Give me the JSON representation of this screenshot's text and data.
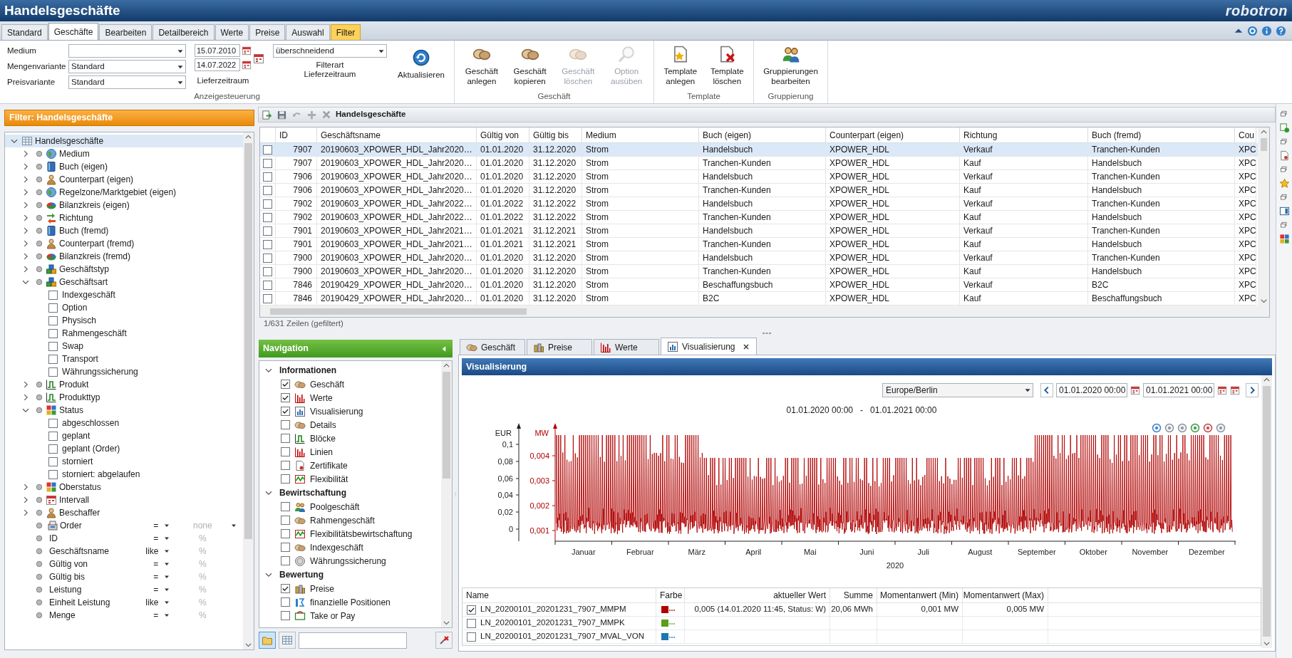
{
  "window": {
    "title": "Handelsgeschäfte",
    "brand": "robotron"
  },
  "tabs": [
    {
      "label": "Standard",
      "selected": false,
      "kind": "normal"
    },
    {
      "label": "Geschäfte",
      "selected": true,
      "kind": "normal"
    },
    {
      "label": "Bearbeiten",
      "selected": false,
      "kind": "normal"
    },
    {
      "label": "Detailbereich",
      "selected": false,
      "kind": "normal"
    },
    {
      "label": "Werte",
      "selected": false,
      "kind": "normal"
    },
    {
      "label": "Preise",
      "selected": false,
      "kind": "normal"
    },
    {
      "label": "Auswahl",
      "selected": false,
      "kind": "normal"
    },
    {
      "label": "Filter",
      "selected": false,
      "kind": "context"
    }
  ],
  "display_settings": {
    "group_label": "Anzeigesteuerung",
    "fields": [
      {
        "label": "Medium"
      },
      {
        "label": "Mengenvariante",
        "value": "Standard"
      },
      {
        "label": "Preisvariante",
        "value": "Standard"
      }
    ],
    "dates": [
      "15.07.2010",
      "14.07.2022"
    ],
    "dates_label": "Lieferzeitraum",
    "filter_mode": "überschneidend",
    "filter_mode_label": "Filterart\nLieferzeitraum",
    "refresh_button": "Aktualisieren"
  },
  "ribbon_groups": [
    {
      "label": "Geschäft",
      "buttons": [
        {
          "label": "Geschäft\nanlegen",
          "disabled": false
        },
        {
          "label": "Geschäft\nkopieren",
          "disabled": false
        },
        {
          "label": "Geschäft\nlöschen",
          "disabled": true
        },
        {
          "label": "Option\nausüben",
          "disabled": true
        }
      ]
    },
    {
      "label": "Template",
      "buttons": [
        {
          "label": "Template\nanlegen",
          "disabled": false
        },
        {
          "label": "Template\nlöschen",
          "disabled": false
        }
      ]
    },
    {
      "label": "Gruppierung",
      "buttons": [
        {
          "label": "Gruppierungen\nbearbeiten",
          "disabled": false
        }
      ]
    }
  ],
  "filter": {
    "title": "Filter: Handelsgeschäfte",
    "tree": {
      "label": "Handelsgeschäfte",
      "expanded": true,
      "selected": true,
      "children": [
        {
          "kind": "category",
          "label": "Medium",
          "expanded": false,
          "selected": false
        },
        {
          "kind": "category",
          "label": "Buch (eigen)",
          "expanded": false,
          "selected": false
        },
        {
          "kind": "category",
          "label": "Counterpart (eigen)",
          "expanded": false,
          "selected": false
        },
        {
          "kind": "category",
          "label": "Regelzone/Marktgebiet (eigen)",
          "expanded": false,
          "selected": false
        },
        {
          "kind": "category",
          "label": "Bilanzkreis (eigen)",
          "expanded": false,
          "selected": false
        },
        {
          "kind": "category",
          "label": "Richtung",
          "expanded": false,
          "selected": false
        },
        {
          "kind": "category",
          "label": "Buch (fremd)",
          "expanded": false,
          "selected": false
        },
        {
          "kind": "category",
          "label": "Counterpart (fremd)",
          "expanded": false,
          "selected": false
        },
        {
          "kind": "category",
          "label": "Bilanzkreis (fremd)",
          "expanded": false,
          "selected": false
        },
        {
          "kind": "category",
          "label": "Geschäftstyp",
          "expanded": false,
          "selected": false
        },
        {
          "kind": "category",
          "label": "Geschäftsart",
          "expanded": true,
          "selected": false,
          "children": [
            {
              "label": "Indexgeschäft",
              "checked": false
            },
            {
              "label": "Option",
              "checked": false
            },
            {
              "label": "Physisch",
              "checked": false
            },
            {
              "label": "Rahmengeschäft",
              "checked": false
            },
            {
              "label": "Swap",
              "checked": false
            },
            {
              "label": "Transport",
              "checked": false
            },
            {
              "label": "Währungssicherung",
              "checked": false
            }
          ]
        },
        {
          "kind": "category",
          "label": "Produkt",
          "expanded": false,
          "selected": false
        },
        {
          "kind": "category",
          "label": "Produkttyp",
          "expanded": false,
          "selected": false
        },
        {
          "kind": "category",
          "label": "Status",
          "expanded": true,
          "selected": false,
          "children": [
            {
              "label": "abgeschlossen",
              "checked": false
            },
            {
              "label": "geplant",
              "checked": false
            },
            {
              "label": "geplant (Order)",
              "checked": false
            },
            {
              "label": "storniert",
              "checked": false
            },
            {
              "label": "storniert: abgelaufen",
              "checked": false
            }
          ]
        },
        {
          "kind": "category",
          "label": "Oberstatus",
          "expanded": false,
          "selected": false
        },
        {
          "kind": "category",
          "label": "Intervall",
          "expanded": false,
          "selected": false
        },
        {
          "kind": "category",
          "label": "Beschaffer",
          "expanded": false,
          "selected": false
        },
        {
          "kind": "field",
          "label": "Order",
          "operator": "=",
          "placeholder": "none",
          "list": true,
          "selected": false
        },
        {
          "kind": "field",
          "label": "ID",
          "operator": "=",
          "placeholder": "%",
          "list": false,
          "selected": false
        },
        {
          "kind": "field",
          "label": "Geschäftsname",
          "operator": "like",
          "placeholder": "%",
          "list": false,
          "selected": false
        },
        {
          "kind": "field",
          "label": "Gültig von",
          "operator": "=",
          "placeholder": "%",
          "list": false,
          "selected": false
        },
        {
          "kind": "field",
          "label": "Gültig bis",
          "operator": "=",
          "placeholder": "%",
          "list": false,
          "selected": false
        },
        {
          "kind": "field",
          "label": "Leistung",
          "operator": "=",
          "placeholder": "%",
          "list": false,
          "selected": false
        },
        {
          "kind": "field",
          "label": "Einheit Leistung",
          "operator": "like",
          "placeholder": "%",
          "list": false,
          "selected": false
        },
        {
          "kind": "field",
          "label": "Menge",
          "operator": "=",
          "placeholder": "%",
          "list": false,
          "selected": false
        }
      ]
    }
  },
  "table": {
    "title": "Handelsgeschäfte",
    "columns": [
      "ID",
      "Geschäftsname",
      "Gültig von",
      "Gültig bis",
      "Medium",
      "Buch (eigen)",
      "Counterpart (eigen)",
      "Richtung",
      "Buch (fremd)",
      "Cou"
    ],
    "rows": [
      {
        "selected": true,
        "checked": false,
        "cells": [
          "7907",
          "20190603_XPOWER_HDL_Jahr2020…",
          "01.01.2020",
          "31.12.2020",
          "Strom",
          "Handelsbuch",
          "XPOWER_HDL",
          "Verkauf",
          "Tranchen-Kunden",
          "XPC"
        ]
      },
      {
        "selected": false,
        "checked": false,
        "cells": [
          "7907",
          "20190603_XPOWER_HDL_Jahr2020…",
          "01.01.2020",
          "31.12.2020",
          "Strom",
          "Tranchen-Kunden",
          "XPOWER_HDL",
          "Kauf",
          "Handelsbuch",
          "XPC"
        ]
      },
      {
        "selected": false,
        "checked": false,
        "cells": [
          "7906",
          "20190603_XPOWER_HDL_Jahr2020…",
          "01.01.2020",
          "31.12.2020",
          "Strom",
          "Handelsbuch",
          "XPOWER_HDL",
          "Verkauf",
          "Tranchen-Kunden",
          "XPC"
        ]
      },
      {
        "selected": false,
        "checked": false,
        "cells": [
          "7906",
          "20190603_XPOWER_HDL_Jahr2020…",
          "01.01.2020",
          "31.12.2020",
          "Strom",
          "Tranchen-Kunden",
          "XPOWER_HDL",
          "Kauf",
          "Handelsbuch",
          "XPC"
        ]
      },
      {
        "selected": false,
        "checked": false,
        "cells": [
          "7902",
          "20190603_XPOWER_HDL_Jahr2022…",
          "01.01.2022",
          "31.12.2022",
          "Strom",
          "Handelsbuch",
          "XPOWER_HDL",
          "Verkauf",
          "Tranchen-Kunden",
          "XPC"
        ]
      },
      {
        "selected": false,
        "checked": false,
        "cells": [
          "7902",
          "20190603_XPOWER_HDL_Jahr2022…",
          "01.01.2022",
          "31.12.2022",
          "Strom",
          "Tranchen-Kunden",
          "XPOWER_HDL",
          "Kauf",
          "Handelsbuch",
          "XPC"
        ]
      },
      {
        "selected": false,
        "checked": false,
        "cells": [
          "7901",
          "20190603_XPOWER_HDL_Jahr2021…",
          "01.01.2021",
          "31.12.2021",
          "Strom",
          "Handelsbuch",
          "XPOWER_HDL",
          "Verkauf",
          "Tranchen-Kunden",
          "XPC"
        ]
      },
      {
        "selected": false,
        "checked": false,
        "cells": [
          "7901",
          "20190603_XPOWER_HDL_Jahr2021…",
          "01.01.2021",
          "31.12.2021",
          "Strom",
          "Tranchen-Kunden",
          "XPOWER_HDL",
          "Kauf",
          "Handelsbuch",
          "XPC"
        ]
      },
      {
        "selected": false,
        "checked": false,
        "cells": [
          "7900",
          "20190603_XPOWER_HDL_Jahr2020…",
          "01.01.2020",
          "31.12.2020",
          "Strom",
          "Handelsbuch",
          "XPOWER_HDL",
          "Verkauf",
          "Tranchen-Kunden",
          "XPC"
        ]
      },
      {
        "selected": false,
        "checked": false,
        "cells": [
          "7900",
          "20190603_XPOWER_HDL_Jahr2020…",
          "01.01.2020",
          "31.12.2020",
          "Strom",
          "Tranchen-Kunden",
          "XPOWER_HDL",
          "Kauf",
          "Handelsbuch",
          "XPC"
        ]
      },
      {
        "selected": false,
        "checked": false,
        "cells": [
          "7846",
          "20190429_XPOWER_HDL_Jahr2020…",
          "01.01.2020",
          "31.12.2020",
          "Strom",
          "Beschaffungsbuch",
          "XPOWER_HDL",
          "Verkauf",
          "B2C",
          "XPC"
        ]
      },
      {
        "selected": false,
        "checked": false,
        "cells": [
          "7846",
          "20190429_XPOWER_HDL_Jahr2020…",
          "01.01.2020",
          "31.12.2020",
          "Strom",
          "B2C",
          "XPOWER_HDL",
          "Kauf",
          "Beschaffungsbuch",
          "XPC"
        ]
      }
    ],
    "status": "1/631 Zeilen (gefiltert)"
  },
  "navigation": {
    "title": "Navigation",
    "sections": [
      {
        "label": "Informationen",
        "expanded": true,
        "items": [
          {
            "label": "Geschäft",
            "checked": true
          },
          {
            "label": "Werte",
            "checked": true
          },
          {
            "label": "Visualisierung",
            "checked": true
          },
          {
            "label": "Details",
            "checked": false
          },
          {
            "label": "Blöcke",
            "checked": false
          },
          {
            "label": "Linien",
            "checked": false
          },
          {
            "label": "Zertifikate",
            "checked": false
          },
          {
            "label": "Flexibilität",
            "checked": false
          }
        ]
      },
      {
        "label": "Bewirtschaftung",
        "expanded": true,
        "items": [
          {
            "label": "Poolgeschäft",
            "checked": false
          },
          {
            "label": "Rahmengeschäft",
            "checked": false
          },
          {
            "label": "Flexibilitätsbewirtschaftung",
            "checked": false
          },
          {
            "label": "Indexgeschäft",
            "checked": false
          },
          {
            "label": "Währungssicherung",
            "checked": false
          }
        ]
      },
      {
        "label": "Bewertung",
        "expanded": true,
        "items": [
          {
            "label": "Preise",
            "checked": true
          },
          {
            "label": "finanzielle Positionen",
            "checked": false
          },
          {
            "label": "Take or Pay",
            "checked": false
          }
        ]
      }
    ],
    "view_buttons": [
      {
        "selected": true
      },
      {
        "selected": false
      }
    ]
  },
  "detail_tabs": [
    {
      "label": "Geschäft",
      "selected": false
    },
    {
      "label": "Preise",
      "selected": false
    },
    {
      "label": "Werte",
      "selected": false
    },
    {
      "label": "Visualisierung",
      "selected": true
    }
  ],
  "visualization": {
    "title": "Visualisierung",
    "timezone": "Europe/Berlin",
    "from": "01.01.2020 00:00",
    "to": "01.01.2021 00:00",
    "chart": {
      "title": "01.01.2020 00:00   -   01.01.2021 00:00",
      "left_unit": "EUR",
      "left_ticks": [
        "0,1",
        "0,08",
        "0,06",
        "0,04",
        "0,02",
        "0"
      ],
      "right_unit": "MW",
      "right_ticks": [
        "0,004",
        "0,003",
        "0,002",
        "0,001"
      ],
      "months": [
        "Januar",
        "Februar",
        "März",
        "April",
        "Mai",
        "Juni",
        "Juli",
        "August",
        "September",
        "Oktober",
        "November",
        "Dezember"
      ],
      "year": "2020"
    },
    "legend": {
      "columns": [
        "Name",
        "Farbe",
        "aktueller Wert",
        "Summe",
        "Momentanwert (Min)",
        "Momentanwert (Max)"
      ],
      "rows": [
        {
          "checked": true,
          "name": "LN_20200101_20201231_7907_MMPM",
          "color": "#b00000",
          "current": "0,005 (14.01.2020 11:45, Status: W)",
          "sum": "20,06 MWh",
          "min": "0,001 MW",
          "max": "0,005 MW"
        },
        {
          "checked": false,
          "name": "LN_20200101_20201231_7907_MMPK",
          "color": "#5a9e1a"
        },
        {
          "checked": false,
          "name": "LN_20200101_20201231_7907_MVAL_VON",
          "color": "#1a78b0"
        }
      ]
    }
  }
}
